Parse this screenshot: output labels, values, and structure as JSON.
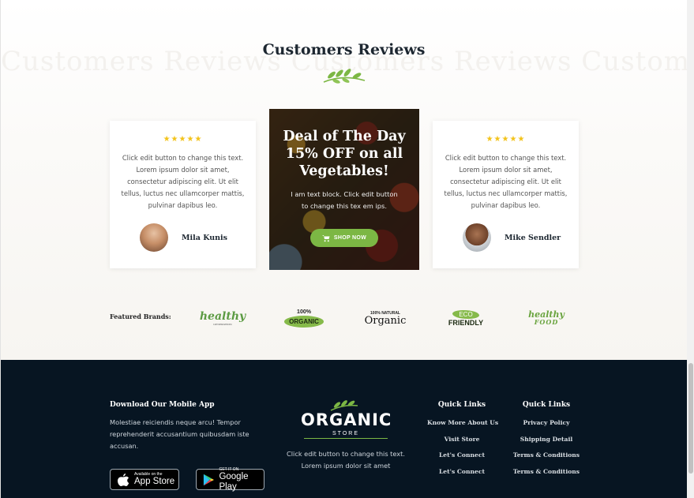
{
  "reviews": {
    "title": "Customers Reviews",
    "watermark": "Customers Reviews Customers Reviews Customers",
    "cards": [
      {
        "stars": "★★★★★",
        "text": "Click edit button to change this text. Lorem ipsum dolor sit amet, consectetur adipiscing elit. Ut elit tellus, luctus nec ullamcorper mattis, pulvinar dapibus leo.",
        "name": "Mila Kunis"
      },
      {
        "stars": "★★★★★",
        "text": "Click edit button to change this text. Lorem ipsum dolor sit amet, consectetur adipiscing elit. Ut elit tellus, luctus nec ullamcorper mattis, pulvinar dapibus leo.",
        "name": "Mike Sendler"
      }
    ]
  },
  "deal": {
    "title": "Deal of The Day 15% OFF on all Vegetables!",
    "text": "I am text block. Click edit button to change this tex em ips.",
    "button_label": "SHOP NOW"
  },
  "brands": {
    "label": "Featured Brands:",
    "items": [
      {
        "name": "healthy",
        "sub": "GENERATION"
      },
      {
        "top": "100%",
        "name": "ORGANIC"
      },
      {
        "top": "100% NATURAL",
        "name": "Organic"
      },
      {
        "top": "ECO",
        "name": "FRIENDLY"
      },
      {
        "top": "healthy",
        "name": "FOOD"
      }
    ]
  },
  "footer": {
    "app_heading": "Download Our Mobile App",
    "app_text": "Molestiae reiciendis neque arcu! Tempor reprehenderit accusantium quibusdam iste accusan.",
    "app_store": {
      "small": "Available on the",
      "big": "App Store"
    },
    "google_play": {
      "small": "GET IT ON",
      "big": "Google Play"
    },
    "logo_word": "ORGANIC",
    "logo_sub": "STORE",
    "center_text": "Click edit button to change this text. Lorem ipsum dolor sit amet",
    "links_col1": {
      "heading": "Quick Links",
      "items": [
        "Know More About Us",
        "Visit Store",
        "Let's Connect",
        "Let's Connect"
      ]
    },
    "links_col2": {
      "heading": "Quick Links",
      "items": [
        "Privacy Policy",
        "Shipping Detail",
        "Terms & Conditions",
        "Terms & Conditions"
      ]
    }
  },
  "colors": {
    "accent_green": "#7cb744",
    "footer_bg": "#071522",
    "star_yellow": "#f3c31a",
    "heading_dark": "#1d2731"
  }
}
